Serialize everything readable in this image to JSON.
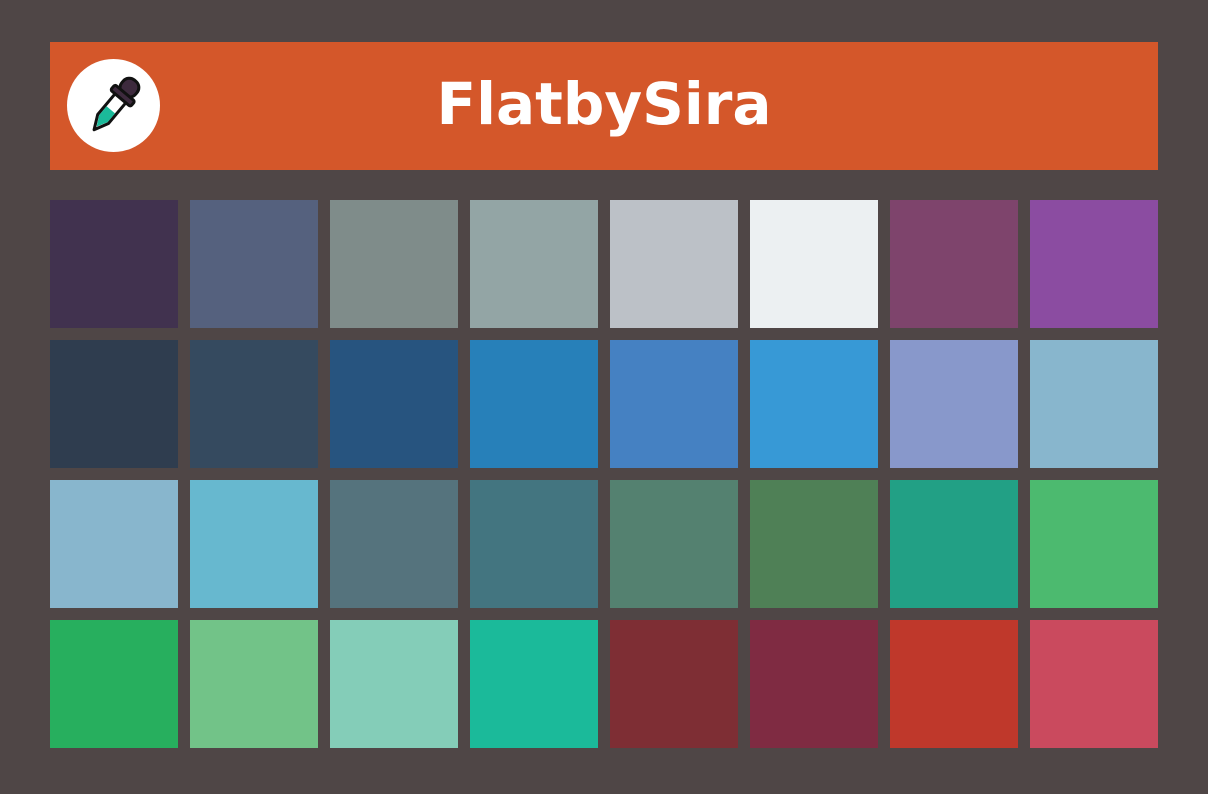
{
  "header": {
    "title": "FlatbySira",
    "background": "#d4572a",
    "logo_icon": "eyedropper-icon"
  },
  "page": {
    "background": "#4f4646"
  },
  "swatches": [
    [
      "#41324f",
      "#55617e",
      "#7f8c8a",
      "#93a5a5",
      "#bcc1c7",
      "#ecf0f2",
      "#7e446c",
      "#8b4ca1"
    ],
    [
      "#2f3d4f",
      "#354a5f",
      "#27547f",
      "#2780b9",
      "#4581c2",
      "#3799d6",
      "#8898cb",
      "#88b6cd"
    ],
    [
      "#88b6cd",
      "#67b8cf",
      "#55737d",
      "#437580",
      "#548170",
      "#4f8056",
      "#22a085",
      "#4cba6f"
    ],
    [
      "#27af5e",
      "#72c388",
      "#84cdb8",
      "#1bba9a",
      "#7e2e34",
      "#7f2b42",
      "#bf382b",
      "#ca4a5e"
    ]
  ]
}
